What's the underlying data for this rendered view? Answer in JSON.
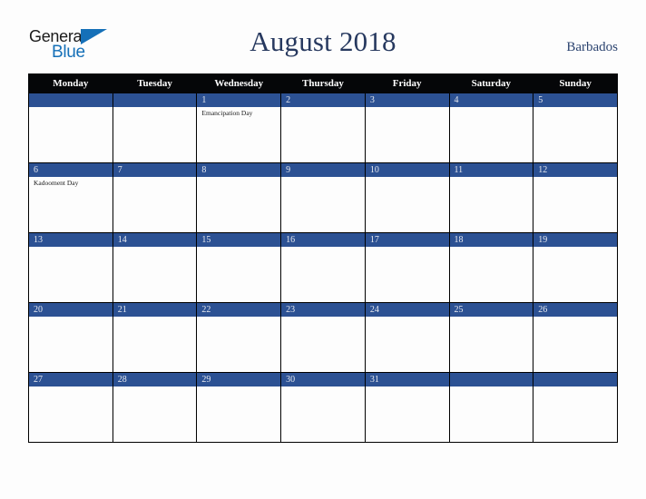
{
  "brand": {
    "name_part1": "General",
    "name_part2": "Blue",
    "triangle_icon": "triangle-icon",
    "accent_color": "#1570b8"
  },
  "header": {
    "title": "August 2018",
    "country": "Barbados"
  },
  "theme": {
    "header_row_bg": "#050608",
    "day_bar_bg": "#2c5193",
    "title_color": "#27395f",
    "page_bg": "#fdfdfd",
    "grid_border": "#000000"
  },
  "calendar": {
    "weekday_headers": [
      "Monday",
      "Tuesday",
      "Wednesday",
      "Thursday",
      "Friday",
      "Saturday",
      "Sunday"
    ],
    "weeks": [
      [
        {
          "day": "",
          "events": []
        },
        {
          "day": "",
          "events": []
        },
        {
          "day": "1",
          "events": [
            "Emancipation Day"
          ]
        },
        {
          "day": "2",
          "events": []
        },
        {
          "day": "3",
          "events": []
        },
        {
          "day": "4",
          "events": []
        },
        {
          "day": "5",
          "events": []
        }
      ],
      [
        {
          "day": "6",
          "events": [
            "Kadooment Day"
          ]
        },
        {
          "day": "7",
          "events": []
        },
        {
          "day": "8",
          "events": []
        },
        {
          "day": "9",
          "events": []
        },
        {
          "day": "10",
          "events": []
        },
        {
          "day": "11",
          "events": []
        },
        {
          "day": "12",
          "events": []
        }
      ],
      [
        {
          "day": "13",
          "events": []
        },
        {
          "day": "14",
          "events": []
        },
        {
          "day": "15",
          "events": []
        },
        {
          "day": "16",
          "events": []
        },
        {
          "day": "17",
          "events": []
        },
        {
          "day": "18",
          "events": []
        },
        {
          "day": "19",
          "events": []
        }
      ],
      [
        {
          "day": "20",
          "events": []
        },
        {
          "day": "21",
          "events": []
        },
        {
          "day": "22",
          "events": []
        },
        {
          "day": "23",
          "events": []
        },
        {
          "day": "24",
          "events": []
        },
        {
          "day": "25",
          "events": []
        },
        {
          "day": "26",
          "events": []
        }
      ],
      [
        {
          "day": "27",
          "events": []
        },
        {
          "day": "28",
          "events": []
        },
        {
          "day": "29",
          "events": []
        },
        {
          "day": "30",
          "events": []
        },
        {
          "day": "31",
          "events": []
        },
        {
          "day": "",
          "events": []
        },
        {
          "day": "",
          "events": []
        }
      ]
    ]
  }
}
